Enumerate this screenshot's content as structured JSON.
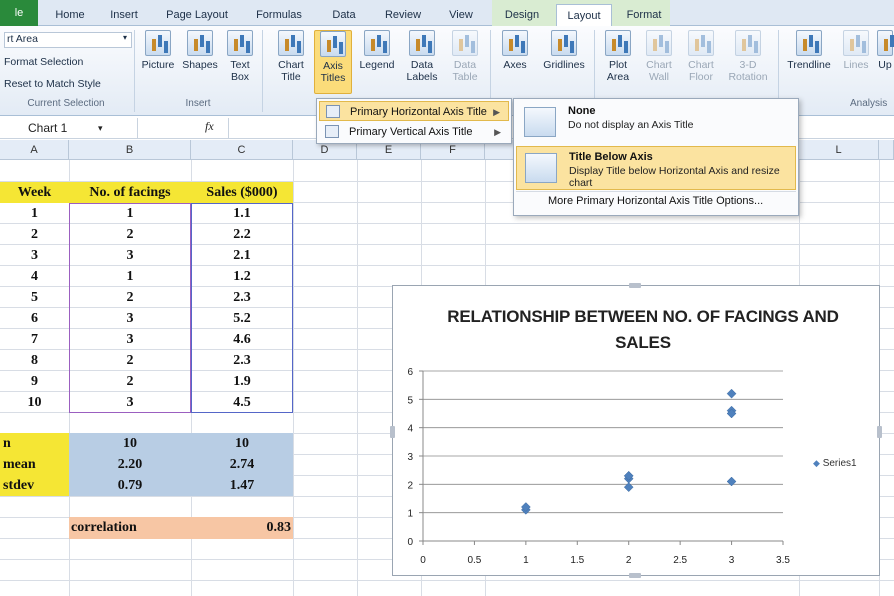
{
  "ribbon": {
    "tabs": [
      "le",
      "Home",
      "Insert",
      "Page Layout",
      "Formulas",
      "Data",
      "Review",
      "View",
      "Design",
      "Layout",
      "Format"
    ],
    "current_selection": {
      "dropdown_value": "rt Area",
      "format_selection": "Format Selection",
      "reset_style": "Reset to Match Style",
      "label": "Current Selection"
    },
    "insert_group": {
      "buttons": [
        "Picture",
        "Shapes",
        "Text Box"
      ],
      "label": "Insert"
    },
    "labels_group": {
      "buttons": [
        "Chart Title",
        "Axis Titles",
        "Legend",
        "Data Labels",
        "Data Table"
      ]
    },
    "axes_group": {
      "buttons": [
        "Axes",
        "Gridlines"
      ]
    },
    "background_group": {
      "buttons": [
        "Plot Area",
        "Chart Wall",
        "Chart Floor",
        "3-D Rotation"
      ]
    },
    "analysis_group": {
      "buttons": [
        "Trendline",
        "Lines",
        "Up"
      ],
      "label": "Analysis"
    }
  },
  "formula_bar": {
    "name_box": "Chart 1",
    "fx_symbol": "fx",
    "formula": ""
  },
  "columns": [
    "A",
    "B",
    "C",
    "D",
    "E",
    "F",
    "L"
  ],
  "axis_titles_menu": {
    "items": [
      "Primary Horizontal Axis Title",
      "Primary Vertical Axis Title"
    ]
  },
  "horizontal_title_submenu": {
    "options": [
      {
        "title": "None",
        "desc": "Do not display an Axis Title"
      },
      {
        "title": "Title Below Axis",
        "desc": "Display Title below Horizontal Axis and resize chart"
      }
    ],
    "more": "More Primary Horizontal Axis Title Options..."
  },
  "table": {
    "headers": [
      "Week",
      "No. of facings",
      "Sales ($000)"
    ],
    "rows": [
      [
        "1",
        "1",
        "1.1"
      ],
      [
        "2",
        "2",
        "2.2"
      ],
      [
        "3",
        "3",
        "2.1"
      ],
      [
        "4",
        "1",
        "1.2"
      ],
      [
        "5",
        "2",
        "2.3"
      ],
      [
        "6",
        "3",
        "5.2"
      ],
      [
        "7",
        "3",
        "4.6"
      ],
      [
        "8",
        "2",
        "2.3"
      ],
      [
        "9",
        "2",
        "1.9"
      ],
      [
        "10",
        "3",
        "4.5"
      ]
    ],
    "stats": [
      [
        "n",
        "10",
        "10"
      ],
      [
        "mean",
        "2.20",
        "2.74"
      ],
      [
        "stdev",
        "0.79",
        "1.47"
      ]
    ],
    "correlation_label": "correlation",
    "correlation_value": "0.83"
  },
  "chart_data": {
    "type": "scatter",
    "title": "RELATIONSHIP BETWEEN NO. OF FACINGS AND SALES",
    "series": [
      {
        "name": "Series1",
        "x": [
          1,
          2,
          3,
          1,
          2,
          3,
          3,
          2,
          2,
          3
        ],
        "y": [
          1.1,
          2.2,
          2.1,
          1.2,
          2.3,
          5.2,
          4.6,
          2.3,
          1.9,
          4.5
        ]
      }
    ],
    "xlim": [
      0,
      3.5
    ],
    "ylim": [
      0,
      6
    ],
    "xticks": [
      "0",
      "0.5",
      "1",
      "1.5",
      "2",
      "2.5",
      "3",
      "3.5"
    ],
    "yticks": [
      "0",
      "1",
      "2",
      "3",
      "4",
      "5",
      "6"
    ],
    "grid": "horizontal",
    "legend": "right",
    "marker_color": "#4f81bd"
  }
}
